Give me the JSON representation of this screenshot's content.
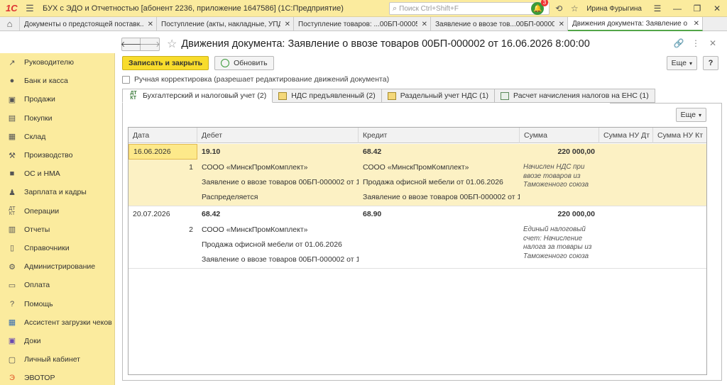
{
  "app": {
    "title": "БУХ с ЭДО и Отчетностью [абонент 2236, приложение 1647586]  (1С:Предприятие)",
    "search_placeholder": "Поиск Ctrl+Shift+F",
    "notifications": "3",
    "user": "Ирина Фурыгина",
    "accent": "#fbeb9e"
  },
  "tabs": [
    {
      "label": "Документы о предстоящей поставк..."
    },
    {
      "label": "Поступление (акты, накладные, УПД)"
    },
    {
      "label": "Поступление товаров: ...00БП-000057"
    },
    {
      "label": "Заявление о ввозе тов...00БП-000002"
    },
    {
      "label": "Движения документа: Заявление о ..."
    }
  ],
  "sidebar": [
    {
      "label": "Руководителю",
      "icon": "chart-up-icon"
    },
    {
      "label": "Банк и касса",
      "icon": "coin-icon"
    },
    {
      "label": "Продажи",
      "icon": "cart-icon"
    },
    {
      "label": "Покупки",
      "icon": "basket-icon"
    },
    {
      "label": "Склад",
      "icon": "warehouse-icon"
    },
    {
      "label": "Производство",
      "icon": "factory-icon"
    },
    {
      "label": "ОС и НМА",
      "icon": "truck-icon"
    },
    {
      "label": "Зарплата и кадры",
      "icon": "person-icon"
    },
    {
      "label": "Операции",
      "icon": "dt-kt-icon"
    },
    {
      "label": "Отчеты",
      "icon": "bar-chart-icon"
    },
    {
      "label": "Справочники",
      "icon": "book-icon"
    },
    {
      "label": "Администрирование",
      "icon": "gear-icon"
    },
    {
      "label": "Оплата",
      "icon": "payment-icon"
    },
    {
      "label": "Помощь",
      "icon": "question-icon"
    },
    {
      "label": "Ассистент загрузки чеков",
      "icon": "grid-icon"
    },
    {
      "label": "Доки",
      "icon": "docs-icon"
    },
    {
      "label": "Личный кабинет",
      "icon": "account-icon"
    },
    {
      "label": "ЭВОТОР",
      "icon": "evotor-icon"
    }
  ],
  "doc": {
    "title": "Движения документа: Заявление о ввозе товаров 00БП-000002 от 16.06.2026 8:00:00",
    "save_label": "Записать и закрыть",
    "refresh_label": "Обновить",
    "more_label": "Еще",
    "help_label": "?",
    "manual_label": "Ручная корректировка (разрешает редактирование движений документа)"
  },
  "doc_tabs": [
    {
      "label": "Бухгалтерский и налоговый учет (2)",
      "icon": "dt-kt-icon"
    },
    {
      "label": "НДС предъявленный (2)",
      "icon": "register-icon"
    },
    {
      "label": "Раздельный учет НДС (1)",
      "icon": "register-icon"
    },
    {
      "label": "Расчет начисления налогов на ЕНС (1)",
      "icon": "table-icon"
    }
  ],
  "grid": {
    "columns": [
      "Дата",
      "Дебет",
      "Кредит",
      "Сумма",
      "Сумма НУ Дт",
      "Сумма НУ Кт"
    ],
    "rows": [
      {
        "date": "16.06.2026",
        "num": "1",
        "debit": "19.10",
        "credit": "68.42",
        "sum": "220 000,00",
        "debit_sub": [
          "СООО «МинскПромКомплект»",
          "Заявление о ввозе товаров 00БП-000002 от 1...",
          "Распределяется"
        ],
        "credit_sub": [
          "СООО «МинскПромКомплект»",
          "Продажа офисной мебели от 01.06.2026",
          "Заявление о ввозе товаров 00БП-000002 от 1..."
        ],
        "desc": "Начислен НДС при ввозе товаров из Таможенного союза"
      },
      {
        "date": "20.07.2026",
        "num": "2",
        "debit": "68.42",
        "credit": "68.90",
        "sum": "220 000,00",
        "debit_sub": [
          "СООО «МинскПромКомплект»",
          "Продажа офисной мебели от 01.06.2026",
          "Заявление о ввозе товаров 00БП-000002 от 1..."
        ],
        "credit_sub": [
          "",
          "",
          ""
        ],
        "desc": "Единый налоговый счет: Начисление налога за товары из Таможенного союза"
      }
    ]
  }
}
